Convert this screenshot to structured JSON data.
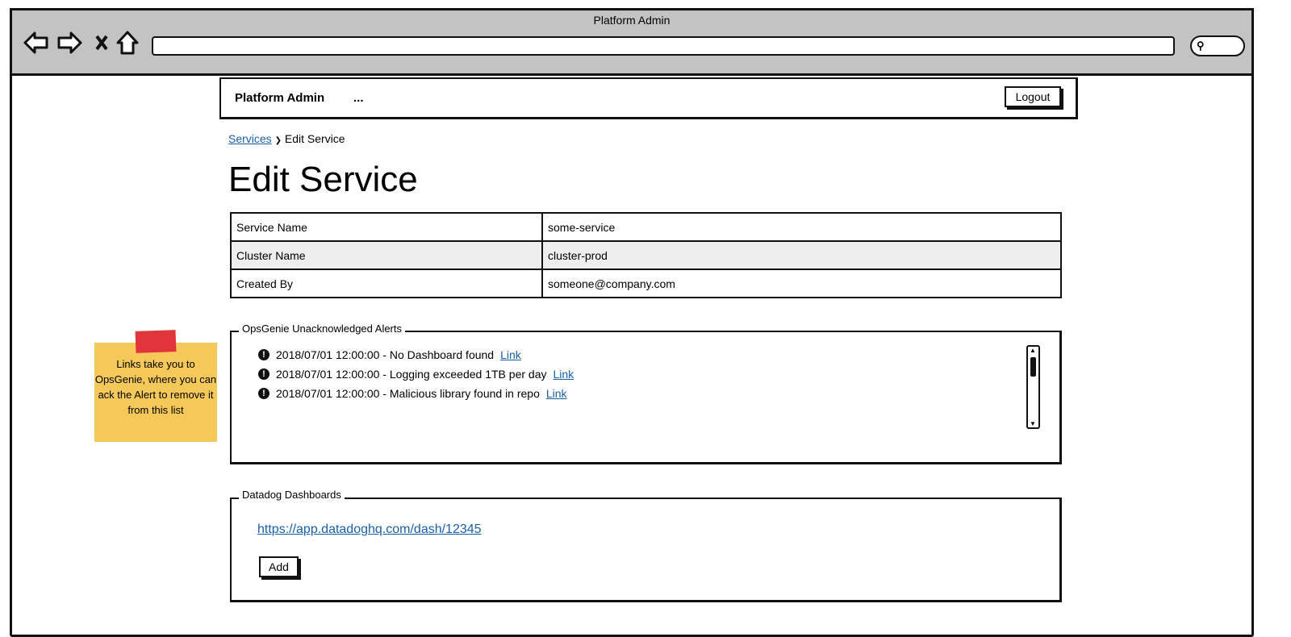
{
  "window": {
    "title": "Platform Admin"
  },
  "navbar": {
    "brand": "Platform Admin",
    "more": "...",
    "logout_label": "Logout"
  },
  "breadcrumb": {
    "parent": "Services",
    "separator": "❯",
    "current": "Edit Service"
  },
  "page_title": "Edit Service",
  "details": [
    {
      "label": "Service Name",
      "value": "some-service"
    },
    {
      "label": "Cluster Name",
      "value": "cluster-prod"
    },
    {
      "label": "Created By",
      "value": "someone@company.com"
    }
  ],
  "alerts": {
    "title": "OpsGenie Unacknowledged Alerts",
    "items": [
      {
        "text": "2018/07/01 12:00:00 - No Dashboard found",
        "link": "Link"
      },
      {
        "text": "2018/07/01 12:00:00 - Logging exceeded 1TB per day",
        "link": "Link"
      },
      {
        "text": "2018/07/01 12:00:00 - Malicious library found in repo",
        "link": "Link"
      }
    ]
  },
  "dashboards": {
    "title": "Datadog Dashboards",
    "link": "https://app.datadoghq.com/dash/12345",
    "add_label": "Add"
  },
  "sticky_note": "Links take you to OpsGenie, where you can ack the Alert to remove it from this list"
}
